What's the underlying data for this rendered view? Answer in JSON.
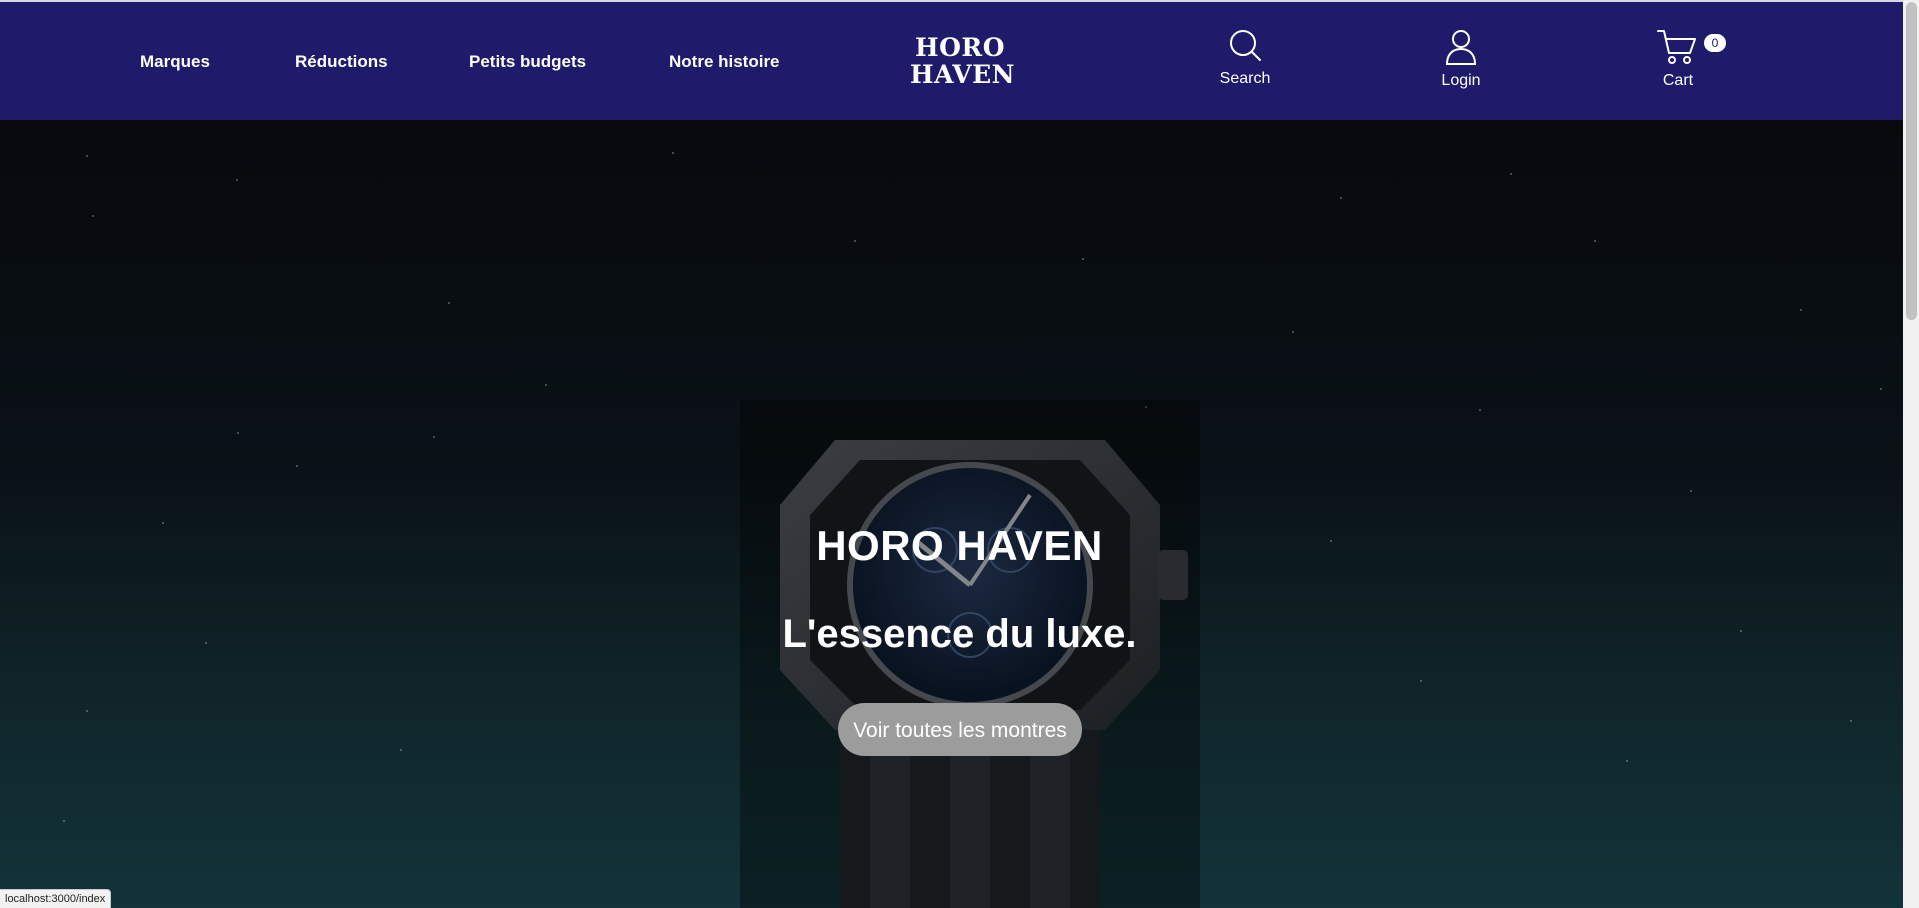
{
  "nav": {
    "links": [
      {
        "label": "Marques"
      },
      {
        "label": "Réductions"
      },
      {
        "label": "Petits budgets"
      },
      {
        "label": "Notre histoire"
      }
    ],
    "logo_line1": "HORO",
    "logo_line2": "HAVEN",
    "search_label": "Search",
    "login_label": "Login",
    "cart_label": "Cart",
    "cart_count": "0"
  },
  "hero": {
    "title": "HORO HAVEN",
    "subtitle": "L'essence du luxe.",
    "button_label": "Voir toutes les montres"
  },
  "status_bar": {
    "url": "localhost:3000/index"
  },
  "colors": {
    "navbar_bg": "#1e1b6b",
    "hero_button_bg": "#9c9c9c",
    "text": "#ffffff"
  },
  "icons": {
    "search": "search-icon",
    "login": "user-icon",
    "cart": "cart-icon"
  }
}
